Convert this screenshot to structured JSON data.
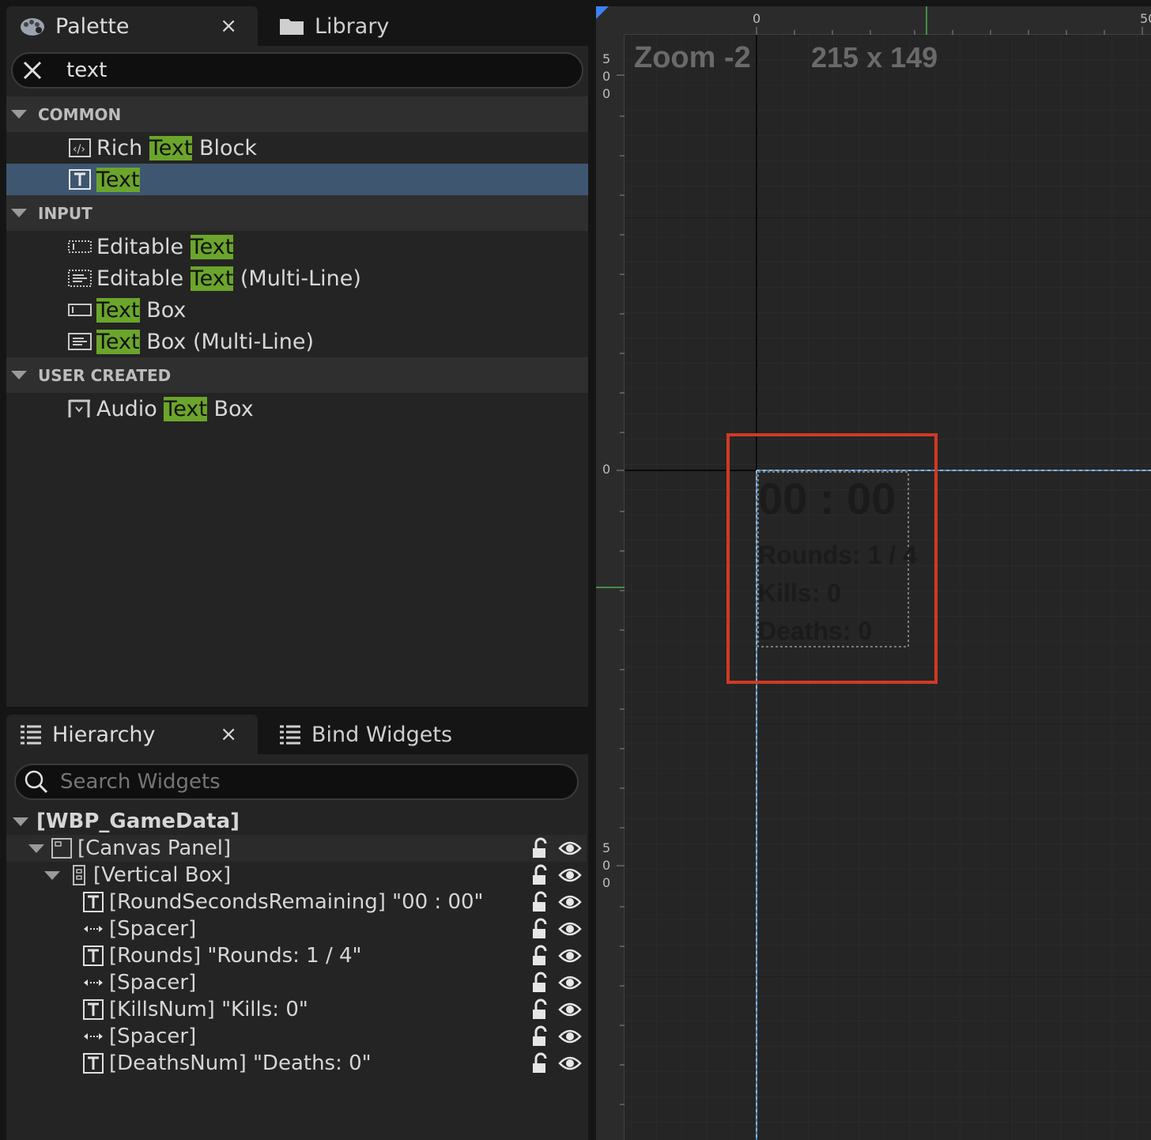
{
  "palette": {
    "tab_label": "Palette",
    "tab_close": "×",
    "library_tab_label": "Library",
    "search": {
      "value": "text",
      "clear_icon": "close-icon"
    },
    "categories": [
      {
        "name": "COMMON",
        "items": [
          {
            "pre": "Rich ",
            "match": "Text",
            "post": " Block",
            "icon": "rich-text-icon"
          },
          {
            "pre": "",
            "match": "Text",
            "post": "",
            "icon": "text-block-icon",
            "selected": true
          }
        ]
      },
      {
        "name": "INPUT",
        "items": [
          {
            "pre": "Editable ",
            "match": "Text",
            "post": "",
            "icon": "editable-text-icon"
          },
          {
            "pre": "Editable ",
            "match": "Text",
            "post": " (Multi-Line)",
            "icon": "editable-multiline-icon"
          },
          {
            "pre": "",
            "match": "Text",
            "post": " Box",
            "icon": "text-box-icon"
          },
          {
            "pre": "",
            "match": "Text",
            "post": " Box (Multi-Line)",
            "icon": "text-box-multiline-icon"
          }
        ]
      },
      {
        "name": "USER CREATED",
        "items": [
          {
            "pre": "Audio ",
            "match": "Text",
            "post": " Box",
            "icon": "audio-text-box-icon"
          }
        ]
      }
    ],
    "highlight_color": "#6ba52b",
    "selected_color": "#3f5670"
  },
  "hierarchy": {
    "tab_label": "Hierarchy",
    "tab_close": "×",
    "bind_tab_label": "Bind Widgets",
    "search_placeholder": "Search Widgets",
    "root": "[WBP_GameData]",
    "rows": [
      {
        "label": "[Canvas Panel]",
        "icon": "canvas-panel-icon"
      },
      {
        "label": "[Vertical Box]",
        "icon": "vertical-box-icon"
      },
      {
        "label": "[RoundSecondsRemaining] \"00 : 00\"",
        "icon": "text-icon"
      },
      {
        "label": "[Spacer]",
        "icon": "spacer-icon"
      },
      {
        "label": "[Rounds] \"Rounds: 1 / 4\"",
        "icon": "text-icon"
      },
      {
        "label": "[Spacer]",
        "icon": "spacer-icon"
      },
      {
        "label": "[KillsNum] \"Kills: 0\"",
        "icon": "text-icon"
      },
      {
        "label": "[Spacer]",
        "icon": "spacer-icon"
      },
      {
        "label": "[DeathsNum] \"Deaths: 0\"",
        "icon": "text-icon"
      }
    ]
  },
  "designer": {
    "zoom_label": "Zoom -2",
    "size_label": "215 x 149",
    "ruler_top": [
      "0",
      "50"
    ],
    "ruler_left": [
      "500",
      "0",
      "500"
    ],
    "widget_texts": [
      "00 : 00",
      "Rounds: 1 / 4",
      "Kills: 0",
      "Deaths: 0"
    ],
    "highlight_box_color": "#d03a22",
    "guide_color": "#4aa3f0"
  }
}
